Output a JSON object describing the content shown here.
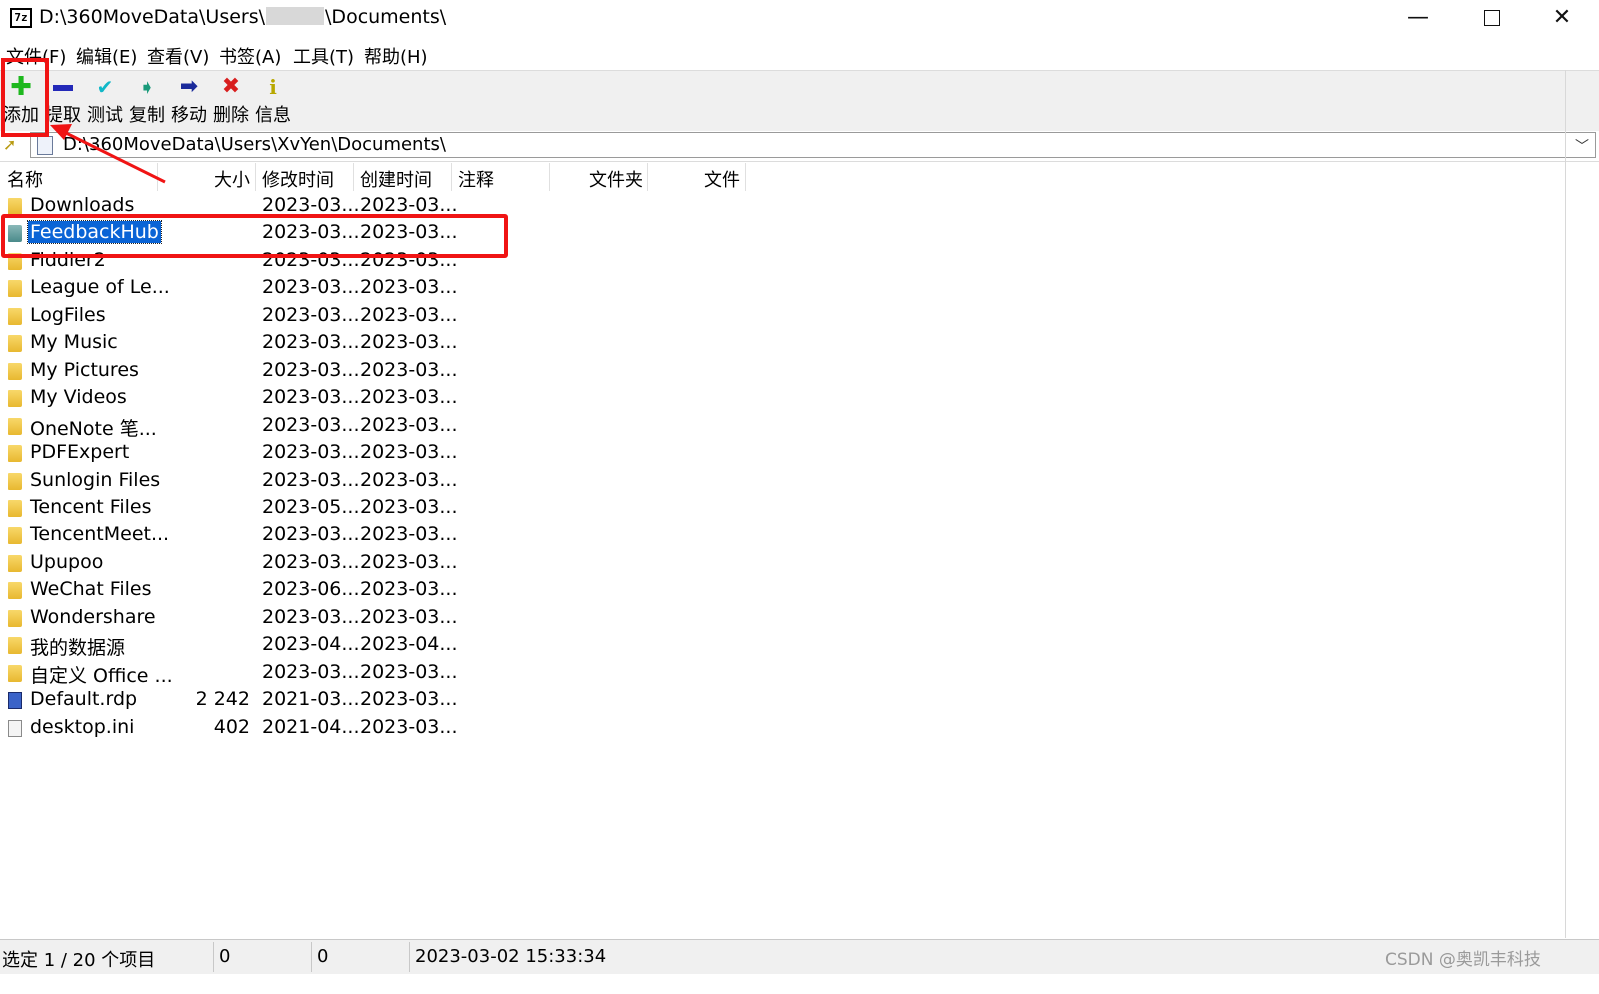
{
  "window": {
    "title_prefix": "D:\\360MoveData\\Users\\",
    "title_suffix": "\\Documents\\",
    "app_icon_text": "7z",
    "minimize": "—",
    "close": "✕"
  },
  "menu": [
    "文件(F)",
    "编辑(E)",
    "查看(V)",
    "书签(A)",
    "工具(T)",
    "帮助(H)"
  ],
  "toolbar": [
    {
      "label": "添加",
      "icon": "plus-icon"
    },
    {
      "label": "提取",
      "icon": "minus-icon"
    },
    {
      "label": "测试",
      "icon": "check-icon"
    },
    {
      "label": "复制",
      "icon": "copy-arrow-icon"
    },
    {
      "label": "移动",
      "icon": "move-arrow-icon"
    },
    {
      "label": "删除",
      "icon": "delete-x-icon"
    },
    {
      "label": "信息",
      "icon": "info-icon"
    }
  ],
  "address": {
    "path": "D:\\360MoveData\\Users\\XvYen\\Documents\\"
  },
  "columns": [
    "名称",
    "大小",
    "修改时间",
    "创建时间",
    "注释",
    "文件夹",
    "文件"
  ],
  "files": [
    {
      "name": "Downloads",
      "size": "",
      "modified": "2023-03...",
      "created": "2023-03...",
      "type": "folder"
    },
    {
      "name": "FeedbackHub",
      "size": "",
      "modified": "2023-03...",
      "created": "2023-03...",
      "type": "folder",
      "selected": true
    },
    {
      "name": "Fiddler2",
      "size": "",
      "modified": "2023-03...",
      "created": "2023-03...",
      "type": "folder"
    },
    {
      "name": "League of Le...",
      "size": "",
      "modified": "2023-03...",
      "created": "2023-03...",
      "type": "folder"
    },
    {
      "name": "LogFiles",
      "size": "",
      "modified": "2023-03...",
      "created": "2023-03...",
      "type": "folder"
    },
    {
      "name": "My Music",
      "size": "",
      "modified": "2023-03...",
      "created": "2023-03...",
      "type": "folder"
    },
    {
      "name": "My Pictures",
      "size": "",
      "modified": "2023-03...",
      "created": "2023-03...",
      "type": "folder"
    },
    {
      "name": "My Videos",
      "size": "",
      "modified": "2023-03...",
      "created": "2023-03...",
      "type": "folder"
    },
    {
      "name": "OneNote 笔...",
      "size": "",
      "modified": "2023-03...",
      "created": "2023-03...",
      "type": "folder"
    },
    {
      "name": "PDFExpert",
      "size": "",
      "modified": "2023-03...",
      "created": "2023-03...",
      "type": "folder"
    },
    {
      "name": "Sunlogin Files",
      "size": "",
      "modified": "2023-03...",
      "created": "2023-03...",
      "type": "folder"
    },
    {
      "name": "Tencent Files",
      "size": "",
      "modified": "2023-05...",
      "created": "2023-03...",
      "type": "folder"
    },
    {
      "name": "TencentMeet...",
      "size": "",
      "modified": "2023-03...",
      "created": "2023-03...",
      "type": "folder"
    },
    {
      "name": "Upupoo",
      "size": "",
      "modified": "2023-03...",
      "created": "2023-03...",
      "type": "folder"
    },
    {
      "name": "WeChat Files",
      "size": "",
      "modified": "2023-06...",
      "created": "2023-03...",
      "type": "folder"
    },
    {
      "name": "Wondershare",
      "size": "",
      "modified": "2023-03...",
      "created": "2023-03...",
      "type": "folder"
    },
    {
      "name": "我的数据源",
      "size": "",
      "modified": "2023-04...",
      "created": "2023-04...",
      "type": "folder"
    },
    {
      "name": "自定义 Office ...",
      "size": "",
      "modified": "2023-03...",
      "created": "2023-03...",
      "type": "folder"
    },
    {
      "name": "Default.rdp",
      "size": "2 242",
      "modified": "2021-03...",
      "created": "2023-03...",
      "type": "rdp"
    },
    {
      "name": "desktop.ini",
      "size": "402",
      "modified": "2021-04...",
      "created": "2023-03...",
      "type": "ini"
    }
  ],
  "status": {
    "selection": "选定 1 / 20 个项目",
    "size": "0",
    "packed": "0",
    "datetime": "2023-03-02 15:33:34"
  },
  "watermark": "CSDN @奥凯丰科技",
  "colors": {
    "selection_bg": "#0a64d6",
    "annotation": "#f01414",
    "toolbar_bg": "#f0f0f0"
  }
}
